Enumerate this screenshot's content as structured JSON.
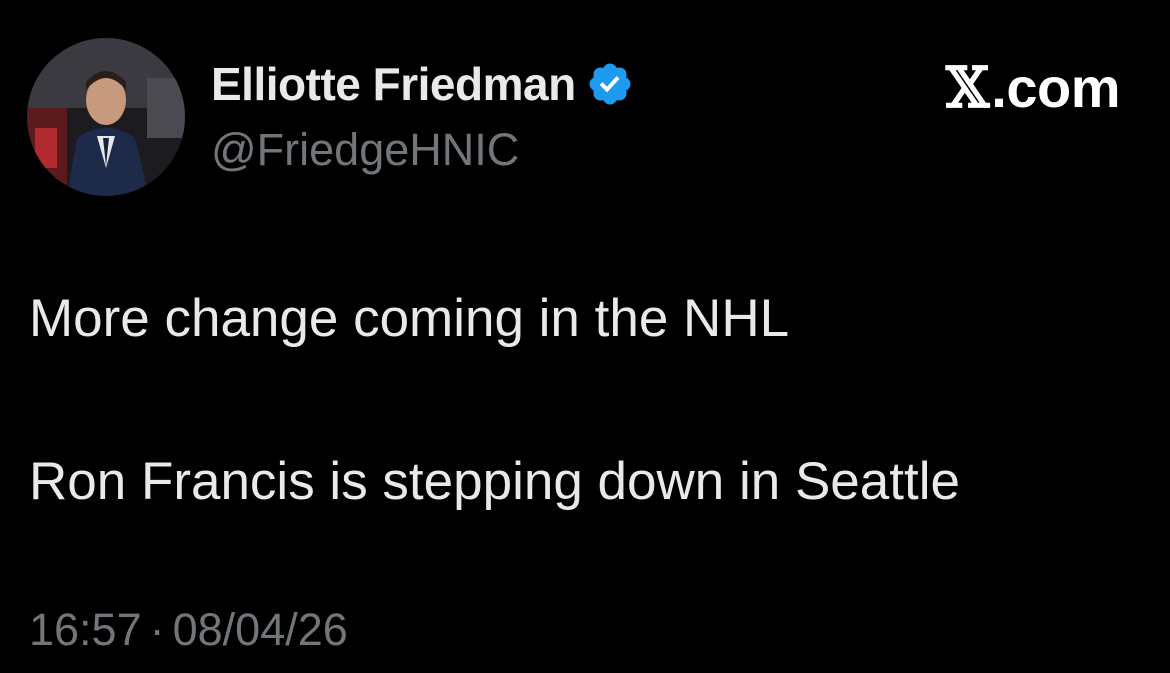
{
  "author": {
    "display_name": "Elliotte Friedman",
    "handle": "@FriedgeHNIC",
    "verified": true,
    "verified_color": "#1d9bf0",
    "avatar_icon": "profile-photo"
  },
  "site": {
    "logo_glyph": "𝕏",
    "domain": ".com"
  },
  "tweet": {
    "lines": [
      "More change coming in the NHL",
      "Ron Francis is stepping down in Seattle"
    ]
  },
  "meta": {
    "time": "16:57",
    "separator": "·",
    "date": "08/04/26"
  },
  "colors": {
    "background": "#000000",
    "text_primary": "#e7e9ea",
    "text_secondary": "#71767b"
  }
}
